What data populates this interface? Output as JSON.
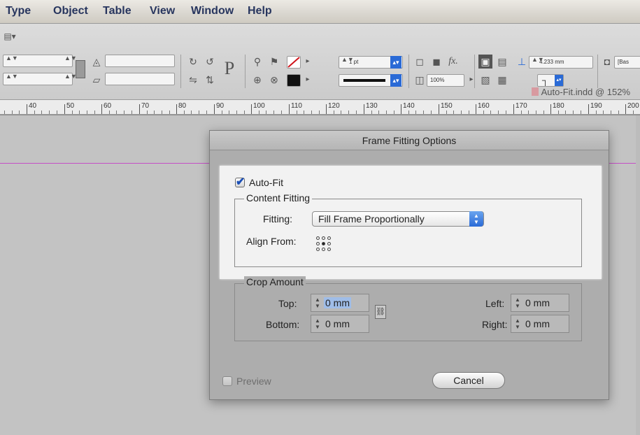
{
  "menubar": {
    "items": [
      "Type",
      "Object",
      "Table",
      "View",
      "Window",
      "Help"
    ]
  },
  "control_panel": {
    "stroke_weight": "1 pt",
    "scale": "100%",
    "gap_value": "4.233 mm",
    "style_field": "[Bas"
  },
  "ruler": {
    "marks": [
      "40",
      "50",
      "60",
      "70",
      "80",
      "90",
      "100",
      "110",
      "120",
      "130",
      "140",
      "150",
      "160",
      "170",
      "180",
      "190",
      "200",
      "2"
    ]
  },
  "document": {
    "title": "Auto-Fit.indd @ 152%"
  },
  "dialog": {
    "title": "Frame Fitting Options",
    "auto_fit_label": "Auto-Fit",
    "auto_fit_checked": true,
    "content_fitting": {
      "group_label": "Content Fitting",
      "fitting_label": "Fitting:",
      "fitting_value": "Fill Frame Proportionally",
      "align_from_label": "Align From:"
    },
    "crop_amount": {
      "group_label": "Crop Amount",
      "top_label": "Top:",
      "top_value": "0 mm",
      "bottom_label": "Bottom:",
      "bottom_value": "0 mm",
      "left_label": "Left:",
      "left_value": "0 mm",
      "right_label": "Right:",
      "right_value": "0 mm"
    },
    "preview_label": "Preview",
    "cancel_label": "Cancel"
  },
  "colors": {
    "accent": "#2a6ad6",
    "margin_guide": "#c54fc6"
  }
}
